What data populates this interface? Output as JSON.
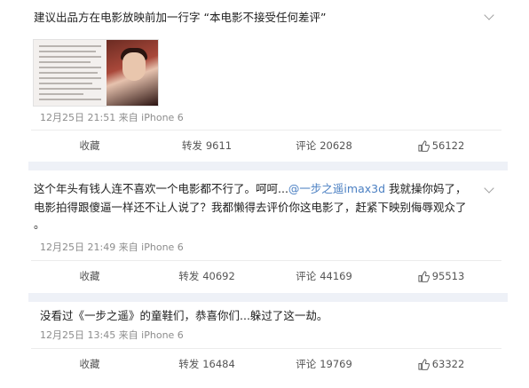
{
  "posts": [
    {
      "text_line1": "建议出品方在电影放映前加一行字 “本电影不接受任何差评”",
      "meta": "12月25日 21:51 来自 iPhone 6",
      "actions": {
        "favorite": "收藏",
        "repost": "转发",
        "repost_count": "9611",
        "comment": "评论",
        "comment_count": "20628",
        "like_count": "56122"
      }
    },
    {
      "text_line1_pre": "这个年头有钱人连不喜欢一个电影都不行了。呵呵...",
      "mention": "@一步之遥imax3d",
      "text_line1_post": " 我就操你妈了，",
      "text_line2": "电影拍得跟傻逼一样还不让人说了？我都懒得去评价你这电影了，赶紧下映别侮辱观众了",
      "text_line3": "。",
      "meta": "12月25日 21:49 来自 iPhone 6",
      "actions": {
        "favorite": "收藏",
        "repost": "转发",
        "repost_count": "40692",
        "comment": "评论",
        "comment_count": "44169",
        "like_count": "95513"
      }
    },
    {
      "text_line1": "没看过《一步之遥》的童鞋们，恭喜你们...躲过了这一劫。",
      "meta": "12月25日 13:45 来自 iPhone 6",
      "actions": {
        "favorite": "收藏",
        "repost": "转发",
        "repost_count": "16484",
        "comment": "评论",
        "comment_count": "19769",
        "like_count": "63322"
      }
    }
  ]
}
